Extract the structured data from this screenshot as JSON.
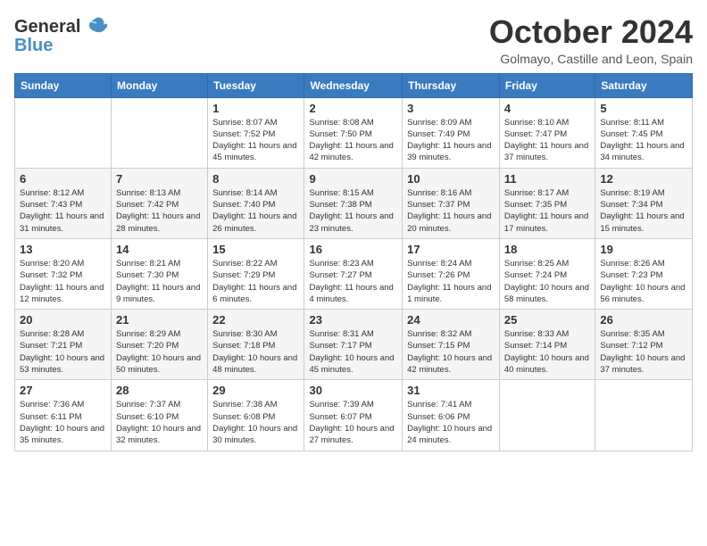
{
  "logo": {
    "general": "General",
    "blue": "Blue",
    "bird_unicode": "🐦"
  },
  "title": "October 2024",
  "subtitle": "Golmayo, Castille and Leon, Spain",
  "headers": [
    "Sunday",
    "Monday",
    "Tuesday",
    "Wednesday",
    "Thursday",
    "Friday",
    "Saturday"
  ],
  "weeks": [
    [
      {
        "num": "",
        "info": ""
      },
      {
        "num": "",
        "info": ""
      },
      {
        "num": "1",
        "info": "Sunrise: 8:07 AM\nSunset: 7:52 PM\nDaylight: 11 hours and 45 minutes."
      },
      {
        "num": "2",
        "info": "Sunrise: 8:08 AM\nSunset: 7:50 PM\nDaylight: 11 hours and 42 minutes."
      },
      {
        "num": "3",
        "info": "Sunrise: 8:09 AM\nSunset: 7:49 PM\nDaylight: 11 hours and 39 minutes."
      },
      {
        "num": "4",
        "info": "Sunrise: 8:10 AM\nSunset: 7:47 PM\nDaylight: 11 hours and 37 minutes."
      },
      {
        "num": "5",
        "info": "Sunrise: 8:11 AM\nSunset: 7:45 PM\nDaylight: 11 hours and 34 minutes."
      }
    ],
    [
      {
        "num": "6",
        "info": "Sunrise: 8:12 AM\nSunset: 7:43 PM\nDaylight: 11 hours and 31 minutes."
      },
      {
        "num": "7",
        "info": "Sunrise: 8:13 AM\nSunset: 7:42 PM\nDaylight: 11 hours and 28 minutes."
      },
      {
        "num": "8",
        "info": "Sunrise: 8:14 AM\nSunset: 7:40 PM\nDaylight: 11 hours and 26 minutes."
      },
      {
        "num": "9",
        "info": "Sunrise: 8:15 AM\nSunset: 7:38 PM\nDaylight: 11 hours and 23 minutes."
      },
      {
        "num": "10",
        "info": "Sunrise: 8:16 AM\nSunset: 7:37 PM\nDaylight: 11 hours and 20 minutes."
      },
      {
        "num": "11",
        "info": "Sunrise: 8:17 AM\nSunset: 7:35 PM\nDaylight: 11 hours and 17 minutes."
      },
      {
        "num": "12",
        "info": "Sunrise: 8:19 AM\nSunset: 7:34 PM\nDaylight: 11 hours and 15 minutes."
      }
    ],
    [
      {
        "num": "13",
        "info": "Sunrise: 8:20 AM\nSunset: 7:32 PM\nDaylight: 11 hours and 12 minutes."
      },
      {
        "num": "14",
        "info": "Sunrise: 8:21 AM\nSunset: 7:30 PM\nDaylight: 11 hours and 9 minutes."
      },
      {
        "num": "15",
        "info": "Sunrise: 8:22 AM\nSunset: 7:29 PM\nDaylight: 11 hours and 6 minutes."
      },
      {
        "num": "16",
        "info": "Sunrise: 8:23 AM\nSunset: 7:27 PM\nDaylight: 11 hours and 4 minutes."
      },
      {
        "num": "17",
        "info": "Sunrise: 8:24 AM\nSunset: 7:26 PM\nDaylight: 11 hours and 1 minute."
      },
      {
        "num": "18",
        "info": "Sunrise: 8:25 AM\nSunset: 7:24 PM\nDaylight: 10 hours and 58 minutes."
      },
      {
        "num": "19",
        "info": "Sunrise: 8:26 AM\nSunset: 7:23 PM\nDaylight: 10 hours and 56 minutes."
      }
    ],
    [
      {
        "num": "20",
        "info": "Sunrise: 8:28 AM\nSunset: 7:21 PM\nDaylight: 10 hours and 53 minutes."
      },
      {
        "num": "21",
        "info": "Sunrise: 8:29 AM\nSunset: 7:20 PM\nDaylight: 10 hours and 50 minutes."
      },
      {
        "num": "22",
        "info": "Sunrise: 8:30 AM\nSunset: 7:18 PM\nDaylight: 10 hours and 48 minutes."
      },
      {
        "num": "23",
        "info": "Sunrise: 8:31 AM\nSunset: 7:17 PM\nDaylight: 10 hours and 45 minutes."
      },
      {
        "num": "24",
        "info": "Sunrise: 8:32 AM\nSunset: 7:15 PM\nDaylight: 10 hours and 42 minutes."
      },
      {
        "num": "25",
        "info": "Sunrise: 8:33 AM\nSunset: 7:14 PM\nDaylight: 10 hours and 40 minutes."
      },
      {
        "num": "26",
        "info": "Sunrise: 8:35 AM\nSunset: 7:12 PM\nDaylight: 10 hours and 37 minutes."
      }
    ],
    [
      {
        "num": "27",
        "info": "Sunrise: 7:36 AM\nSunset: 6:11 PM\nDaylight: 10 hours and 35 minutes."
      },
      {
        "num": "28",
        "info": "Sunrise: 7:37 AM\nSunset: 6:10 PM\nDaylight: 10 hours and 32 minutes."
      },
      {
        "num": "29",
        "info": "Sunrise: 7:38 AM\nSunset: 6:08 PM\nDaylight: 10 hours and 30 minutes."
      },
      {
        "num": "30",
        "info": "Sunrise: 7:39 AM\nSunset: 6:07 PM\nDaylight: 10 hours and 27 minutes."
      },
      {
        "num": "31",
        "info": "Sunrise: 7:41 AM\nSunset: 6:06 PM\nDaylight: 10 hours and 24 minutes."
      },
      {
        "num": "",
        "info": ""
      },
      {
        "num": "",
        "info": ""
      }
    ]
  ]
}
